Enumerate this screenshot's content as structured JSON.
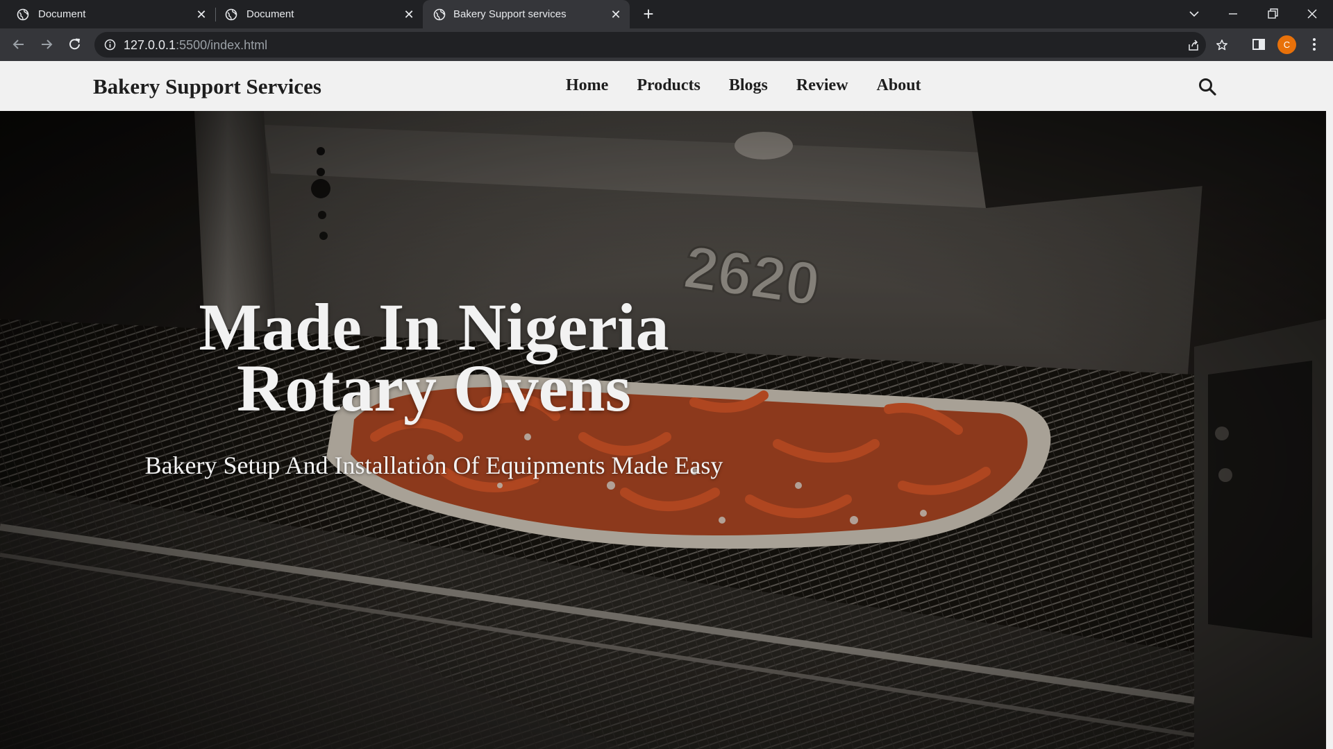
{
  "browser": {
    "tabs": [
      {
        "title": "Document",
        "active": false
      },
      {
        "title": "Document",
        "active": false
      },
      {
        "title": "Bakery Support services",
        "active": true
      }
    ],
    "url_host": "127.0.0.1",
    "url_rest": ":5500/index.html",
    "profile_initial": "C",
    "icons": {
      "tab_favicon": "globe-icon",
      "close": "close-icon",
      "new_tab": "plus-icon",
      "tab_search": "chevron-down-icon",
      "minimize": "minimize-icon",
      "restore": "restore-icon",
      "window_close": "close-icon",
      "back": "back-arrow-icon",
      "forward": "forward-arrow-icon",
      "reload": "reload-icon",
      "site_info": "info-icon",
      "share": "share-icon",
      "bookmark": "star-icon",
      "side_panel": "side-panel-icon",
      "menu": "kebab-menu-icon"
    },
    "colors": {
      "profile": "#e8710a"
    }
  },
  "site": {
    "brand": "Bakery Support Services",
    "nav": [
      "Home",
      "Products",
      "Blogs",
      "Review",
      "About"
    ],
    "search_icon": "search-icon",
    "hero": {
      "title_line1": "Made In Nigeria",
      "title_line2": "Rotary Ovens",
      "subtitle": "Bakery Setup And Installation Of Equipments Made Easy",
      "image_subject": "pizza-in-conveyor-oven"
    }
  }
}
